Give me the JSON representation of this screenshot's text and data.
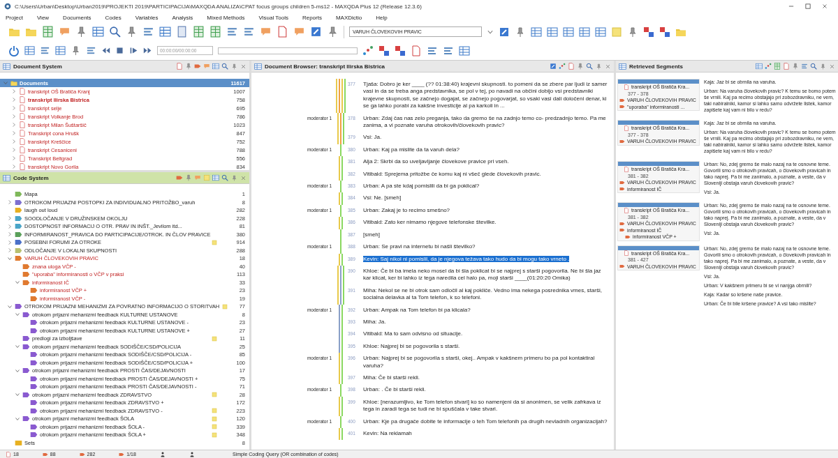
{
  "window": {
    "title": "C:\\Users\\Urban\\Desktop\\Urban2019\\PROJEKTI 2019\\PARTICIPACIJA\\MAXQDA ANALIZA\\CPAT focus groups children 5-ms12 - MAXQDA Plus 12 (Release 12.3.6)"
  },
  "menu": [
    "Project",
    "View",
    "Documents",
    "Codes",
    "Variables",
    "Analysis",
    "Mixed Methods",
    "Visual Tools",
    "Reports",
    "MAXDictio",
    "Help"
  ],
  "toolbar": {
    "code_dropdown": "VARUH ČLOVEKOVIH PRAVIC",
    "time_field": "00:00:00/00:00:00"
  },
  "document_system": {
    "title": "Document System",
    "root": {
      "label": "Documents",
      "count": "11617",
      "expanded": true
    },
    "items": [
      {
        "label": "transkript OŠ Bratiča Kranj",
        "count": "1007",
        "opened": false
      },
      {
        "label": "transkript Ilirska Bistrica",
        "count": "758",
        "opened": true
      },
      {
        "label": "transkript selje",
        "count": "695",
        "opened": false
      },
      {
        "label": "transkript Volkanje Brod",
        "count": "786",
        "opened": false
      },
      {
        "label": "transkript Milan Šuštaršič",
        "count": "1023",
        "opened": false
      },
      {
        "label": "Transkript cona Hrušk",
        "count": "847",
        "opened": false
      },
      {
        "label": "transkript Kreščice",
        "count": "752",
        "opened": false
      },
      {
        "label": "transkript Cesaniceni",
        "count": "788",
        "opened": false
      },
      {
        "label": "Transkript Beltgrad",
        "count": "556",
        "opened": false
      },
      {
        "label": "transkript Novo Gorila",
        "count": "834",
        "opened": false
      }
    ]
  },
  "code_system": {
    "title": "Code System",
    "items": [
      {
        "label": "Mapa",
        "count": "1",
        "color": "#7fb85a",
        "activated": false,
        "memo": false
      },
      {
        "label": "OTROKOM PRIJAZNI POSTOPKI ZA INDIVIDUALNO PRITOŽBO_varuh",
        "count": "8",
        "color": "#7d6fd0",
        "activated": false,
        "memo": false,
        "expanded": false
      },
      {
        "label": "laugh out loud",
        "count": "282",
        "color": "#e8b020",
        "activated": false,
        "memo": false
      },
      {
        "label": "SOODLOČANJE V DRUŽINSKEM OKOLJU",
        "count": "228",
        "color": "#4aa5c8",
        "activated": false,
        "memo": false,
        "expanded": false
      },
      {
        "label": "DOSTOPNOST INFORMACIJ O OTR. PRAV IN INŠT._Jevilom itd...",
        "count": "81",
        "color": "#4aa5c8",
        "activated": false,
        "memo": false,
        "expanded": false
      },
      {
        "label": "INFORMIRANOST_PRAVICA DO PARTICIPACIJE/OTROK. IN ČLOV PRAVICE",
        "count": "380",
        "color": "#5aa05a",
        "activated": false,
        "memo": false,
        "expanded": false
      },
      {
        "label": "POSEBNI FORUMI ZA OTROKE",
        "count": "914",
        "color": "#4a70c8",
        "activated": false,
        "memo": true,
        "expanded": false
      },
      {
        "label": "ODLOČANJE V LOKALNI SKUPNOSTI",
        "count": "288",
        "color": "#b8c070",
        "activated": false,
        "memo": false,
        "expanded": false
      },
      {
        "label": "VARUH ČLOVEKOVIH PRAVIC",
        "count": "18",
        "color": "#e07a30",
        "activated": true,
        "memo": false,
        "expanded": true,
        "children": [
          {
            "label": "znana uloga VČP -",
            "count": "40",
            "color": "#e07a30",
            "activated": true,
            "memo": false
          },
          {
            "label": "\"uporaba\" informiranosti o VČP v praksi",
            "count": "113",
            "color": "#e07a30",
            "activated": true,
            "memo": false
          },
          {
            "label": "informiranost IČ",
            "count": "33",
            "color": "#e07a30",
            "activated": true,
            "memo": false,
            "expanded": true,
            "children": [
              {
                "label": "informiranost VČP +",
                "count": "23",
                "color": "#e07a30",
                "activated": true,
                "memo": false
              },
              {
                "label": "informiranost VČP -",
                "count": "19",
                "color": "#e07a30",
                "activated": true,
                "memo": false
              }
            ]
          }
        ]
      },
      {
        "label": "OTROKOM PRIJAZNI MEHANIZMI ZA POVRATNO INFORMACIJO O STORITVAH",
        "count": "77",
        "color": "#8a5ad0",
        "activated": false,
        "memo": true,
        "expanded": true,
        "children": [
          {
            "label": "otrokom prijazni mehanizmi feedback KULTURNE USTANOVE",
            "count": "8",
            "color": "#8a5ad0",
            "activated": false,
            "memo": false,
            "expanded": true,
            "children": [
              {
                "label": "otrokom prijazni mehanizmi feedback KULTURNE USTANOVE -",
                "count": "23",
                "color": "#8a5ad0",
                "activated": false,
                "memo": false
              },
              {
                "label": "otrokom prijazni mehanizmi feedback KULTURNE USTANOVE +",
                "count": "27",
                "color": "#8a5ad0",
                "activated": false,
                "memo": false
              }
            ]
          },
          {
            "label": "predlogi za izboljšave",
            "count": "11",
            "color": "#8a5ad0",
            "activated": false,
            "memo": true
          },
          {
            "label": "otrokom prijazni mehanizmi feedback SODIŠČE/CSD/POLICIJA",
            "count": "25",
            "color": "#8a5ad0",
            "activated": false,
            "memo": false,
            "expanded": true,
            "children": [
              {
                "label": "otrokom prijazni mehanizmi feedback SODIŠČE/CSD/POLICIJA -",
                "count": "85",
                "color": "#8a5ad0",
                "activated": false,
                "memo": false
              },
              {
                "label": "otrokom prijazni mehanizmi feedback SODIŠČE/CSD/POLICIJA +",
                "count": "100",
                "color": "#8a5ad0",
                "activated": false,
                "memo": false
              }
            ]
          },
          {
            "label": "otrokom prijazni mehanizmi feedback PROSTI ČAS/DEJAVNOSTI",
            "count": "17",
            "color": "#8a5ad0",
            "activated": false,
            "memo": false,
            "expanded": true,
            "children": [
              {
                "label": "otrokom prijazni mehanizmi feedback PROSTI ČAS/DEJAVNOSTI +",
                "count": "75",
                "color": "#8a5ad0",
                "activated": false,
                "memo": false
              },
              {
                "label": "otrokom prijazni mehanizmi feedback PROSTI ČAS/DEJAVNOSTI -",
                "count": "71",
                "color": "#8a5ad0",
                "activated": false,
                "memo": false
              }
            ]
          },
          {
            "label": "otrokom prijazni mehanizmi feedback ZDRAVSTVO",
            "count": "28",
            "color": "#8a5ad0",
            "activated": false,
            "memo": true,
            "expanded": true,
            "children": [
              {
                "label": "otrokom prijazni mehanizmi feedback ZDRAVSTVO +",
                "count": "172",
                "color": "#8a5ad0",
                "activated": false,
                "memo": false
              },
              {
                "label": "otrokom prijazni mehanizmi feedback ZDRAVSTVO -",
                "count": "223",
                "color": "#8a5ad0",
                "activated": false,
                "memo": true
              }
            ]
          },
          {
            "label": "otrokom prijazni mehanizmi feedback ŠOLA",
            "count": "120",
            "color": "#8a5ad0",
            "activated": false,
            "memo": true,
            "expanded": true,
            "children": [
              {
                "label": "otrokom prijazni mehanizmi feedback ŠOLA -",
                "count": "339",
                "color": "#8a5ad0",
                "activated": false,
                "memo": true
              },
              {
                "label": "otrokom prijazni mehanizmi feedback ŠOLA +",
                "count": "348",
                "color": "#8a5ad0",
                "activated": false,
                "memo": true
              }
            ]
          }
        ]
      },
      {
        "label": "Sets",
        "count": "8",
        "color": "#e8b020",
        "activated": false,
        "memo": false,
        "kind": "set"
      }
    ]
  },
  "document_browser": {
    "title": "Document Browser: transkript Ilirska Bistrica",
    "paragraphs": [
      {
        "number": "377",
        "text": "Tjaša: Dobro je ker ____ (?? 01:38:40) krajevni skupnosti. to pomeni da se zbere par ljudi iz samer vasi in da se treba anga predstavnika, se pol v tej, po navadi na občini dobijo vsi predstavniki krajevne skupnosti, se začnejo dogajat, se začnejo pogovarjat, so vsaki vasi dali določeni denar, ki se ga lahko porabi za kakšne investicije al pa karkoli in ...",
        "selected": false,
        "codings": [
          {
            "color": "#e8c94a"
          },
          {
            "color": "#f0a040"
          },
          {
            "color": "#e8c94a"
          },
          {
            "color": "#8ad860"
          }
        ]
      },
      {
        "number": "378",
        "text": "Urban: Zdaj čas nas zelo preganja, tako da gremo še na zadnjo temo co- predzadnjo temo. Pa me zanima, a vi poznate varuha otrokovih/človekovih pravic?",
        "selected": false,
        "label": "moderator 1",
        "codings": [
          {
            "color": "#e8c94a"
          },
          {
            "color": "#f0a040"
          },
          {
            "color": "#8ad860"
          }
        ]
      },
      {
        "number": "379",
        "text": "Vsi: Ja.",
        "selected": false,
        "codings": [
          {
            "color": "#e8c94a"
          },
          {
            "color": "#f0a040"
          },
          {
            "color": "#8ad860"
          }
        ]
      },
      {
        "number": "380",
        "text": "Urban: Kaj pa mislite da ta varuh dela?",
        "selected": false,
        "label": "moderator 1",
        "codings": [
          {
            "color": "#8ad860"
          }
        ]
      },
      {
        "number": "381",
        "text": "Alja 2: Skrbi da so uveljavljanje človekove pravice pri vseh.",
        "selected": false,
        "codings": [
          {
            "color": "#e8c94a"
          },
          {
            "color": "#8ad860"
          }
        ]
      },
      {
        "number": "382",
        "text": "Vitibald: Sprejema pritožbe če komu kaj ni všeč glede človekovih pravic.",
        "selected": false,
        "codings": [
          {
            "color": "#e8c94a"
          },
          {
            "color": "#8ad860"
          }
        ]
      },
      {
        "number": "383",
        "text": "Urban: A pa ste kdaj pomislili da bi ga poklical?",
        "selected": false,
        "label": "moderator 1",
        "codings": [
          {
            "color": "#8ad860"
          }
        ]
      },
      {
        "number": "384",
        "text": "Vsi: Ne. [smeh]",
        "selected": false,
        "codings": [
          {
            "color": "#e8c94a"
          },
          {
            "color": "#8ad860"
          }
        ]
      },
      {
        "number": "385",
        "text": "Urban: Zakaj je to recimo smešno?",
        "selected": false,
        "label": "moderator 1",
        "codings": [
          {
            "color": "#8ad860"
          }
        ]
      },
      {
        "number": "386",
        "text": "Vitibald: Zato ker nimamo njegove telefonske številke.",
        "selected": false,
        "codings": [
          {
            "color": "#e8c94a"
          },
          {
            "color": "#8ad860"
          }
        ]
      },
      {
        "number": "387",
        "text": "[smeh]",
        "selected": false,
        "codings": [
          {
            "color": "#8ad860"
          }
        ]
      },
      {
        "number": "388",
        "text": "Urban: Se pravi na internetu bi našli številko?",
        "selected": false,
        "label": "moderator 1",
        "codings": [
          {
            "color": "#8ad860"
          }
        ]
      },
      {
        "number": "389",
        "text": "Kevin: Saj nikol ni pomislil, da je njegova težava tako hudo da bi mogu tako vrneto .",
        "selected": true,
        "codings": [
          {
            "color": "#e8c94a"
          },
          {
            "color": "#8ad860"
          }
        ]
      },
      {
        "number": "390",
        "text": "Khloe: Če bi ba imela neko mosel da bi šla poklicat bi se najprej s starši pogovorila. Ne bi šla jaz kar klicat, ker bi lahko iz tega naredila cel halo pa, moji starši ____(01:20:20 Omika)",
        "selected": false,
        "codings": [
          {
            "color": "#e8c94a"
          },
          {
            "color": "#8aa0c8"
          },
          {
            "color": "#8ad860"
          }
        ]
      },
      {
        "number": "391",
        "text": "Miha: Nekol se ne bi otrok sam odločil al kaj pokliče. Vedno ima nekega posrednika vmes, starši, socialna delavka al ta Tom telefon, k so telefoni.",
        "selected": false,
        "codings": [
          {
            "color": "#e8c94a"
          },
          {
            "color": "#8aa0c8"
          },
          {
            "color": "#8ad860"
          }
        ]
      },
      {
        "number": "392",
        "text": "Urban: Ampak na Tom telefon bi pa klicala?",
        "selected": false,
        "label": "moderator 1",
        "codings": [
          {
            "color": "#8aa0c8"
          },
          {
            "color": "#8ad860"
          }
        ]
      },
      {
        "number": "393",
        "text": "Miha: Ja.",
        "selected": false,
        "codings": [
          {
            "color": "#8aa0c8"
          },
          {
            "color": "#8ad860"
          }
        ]
      },
      {
        "number": "394",
        "text": "Vitibald: Ma to sam odvisno od situacije.",
        "selected": false,
        "codings": [
          {
            "color": "#8aa0c8"
          },
          {
            "color": "#8ad860"
          }
        ]
      },
      {
        "number": "395",
        "text": "Khloe: Najprej bi se pogovorila s starši.",
        "selected": false,
        "codings": [
          {
            "color": "#8aa0c8"
          },
          {
            "color": "#8ad860"
          }
        ]
      },
      {
        "number": "396",
        "text": "Urban: Najprej bi se pogovorila s starši, okej.. Ampak v kakšnem primeru bo pa pol kontaktiral varuha?",
        "selected": false,
        "label": "moderator 1",
        "codings": [
          {
            "color": "#e8c94a"
          },
          {
            "color": "#8ad860"
          }
        ]
      },
      {
        "number": "397",
        "text": "Miha: Če bi starši rekli.",
        "selected": false,
        "codings": [
          {
            "color": "#e8c94a"
          },
          {
            "color": "#8ad860"
          }
        ]
      },
      {
        "number": "398",
        "text": "Urban: . Če bi starši rekli.",
        "selected": false,
        "label": "moderator 1",
        "codings": [
          {
            "color": "#8ad860"
          }
        ]
      },
      {
        "number": "399",
        "text": "Khloe: [nerazumljivo, ke Tom telefon stvari] ko so namenjeni da si anonimen, se velik zafrkava iz tega in zaradi tega se tudi ne bi spuščala v take stvari.",
        "selected": false,
        "codings": [
          {
            "color": "#e8c94a"
          },
          {
            "color": "#8ad860"
          }
        ]
      },
      {
        "number": "400",
        "text": "Urban: Kje pa drugače dobite te informacije o teh Tom telefonih pa drugih nevladnih organizacijah?",
        "selected": false,
        "label": "moderator 1",
        "codings": [
          {
            "color": "#8ad860"
          }
        ]
      },
      {
        "number": "401",
        "text": "Kevin: Na reklamah",
        "selected": false,
        "codings": [
          {
            "color": "#e8c94a"
          },
          {
            "color": "#8ad860"
          }
        ]
      }
    ]
  },
  "retrieved_segments": {
    "title": "Retrieved Segments",
    "segments": [
      {
        "document": "transkript OŠ Bratiča Kra...",
        "range": "377 - 378",
        "codes": [
          {
            "label": "VARUH ČLOVEKOVIH PRAVIC"
          },
          {
            "label": "\"uporaba\" informiranosti ..."
          }
        ],
        "texts": [
          "Kaja: Jaz bi se obrnila na varuha.",
          "Urban: Na varuha človekovih pravic? K temu se bomo potem še vrnili. Kaj pa recimo obstajajo pri zobozdravniku, ne vem, taki nabiralniki, kamor si lahko samo odvržete listek, kamor zapišete kaj vam ni bilo v redu?"
        ]
      },
      {
        "document": "transkript OŠ Bratiča Kra...",
        "range": "377 - 378",
        "codes": [
          {
            "label": "VARUH ČLOVEKOVIH PRAVIC"
          }
        ],
        "texts": [
          "Kaja: Jaz bi se obrnila na varuha.",
          "Urban: Na varuha človekovih pravic? K temu se bomo potem še vrnili. Kaj pa recimo obstajajo pri zobozdravniku, ne vem, taki nabiralniki, kamor si lahko samo odvržete listek, kamor zapišete kaj vam ni bilo v redu?"
        ]
      },
      {
        "document": "transkript OŠ Bratiča Kra...",
        "range": "381 - 382",
        "codes": [
          {
            "label": "VARUH ČLOVEKOVIH PRAVIC"
          },
          {
            "label": "informiranost IČ"
          }
        ],
        "texts": [
          "Urban: No, zdej gremo še malo nazaj na te osnovne teme. Govorili smo o otrokovih pravicah, o človekovih pravicah in tako naprej. Pa bi me zanimalo, a poznate, a veste, da v Sloveniji obstaja varuh človekovih pravic?",
          "Vsi: Ja."
        ]
      },
      {
        "document": "transkript OŠ Bratiča Kra...",
        "range": "381 - 382",
        "codes": [
          {
            "label": "VARUH ČLOVEKOVIH PRAVIC"
          },
          {
            "label": "informiranost IČ",
            "children": [
              {
                "label": "informiranost VČP +"
              }
            ]
          }
        ],
        "texts": [
          "Urban: No, zdej gremo še malo nazaj na te osnovne teme. Govorili smo o otrokovih pravicah, o človekovih pravicah in tako naprej. Pa bi me zanimalo, a poznate, a veste, da v Sloveniji obstaja varuh človekovih pravic?",
          "Vsi: Ja."
        ]
      },
      {
        "document": "transkript OŠ Bratiča Kra...",
        "range": "381 - 427",
        "codes": [
          {
            "label": "VARUH ČLOVEKOVIH PRAVIC"
          }
        ],
        "texts": [
          "Urban: No, zdej gremo še malo nazaj na te osnovne teme. Govorili smo o otrokovih pravicah, o človekovih pravicah in tako naprej. Pa bi me zanimalo, a poznate, a veste, da v Sloveniji obstaja varuh človekovih pravic?",
          "Vsi: Ja.",
          "Urban: V kakšnem primeru bi se vi nanjga obrnili?",
          "Kaja: Kadar so kršene naše pravice.",
          "Urban: Če bi bile kršene pravice? A vsi tako mislite?"
        ]
      }
    ]
  },
  "status_bar": {
    "counts": [
      "18",
      "88",
      "282",
      "1/18"
    ],
    "query": "Simple Coding Query (OR combination of codes)"
  }
}
